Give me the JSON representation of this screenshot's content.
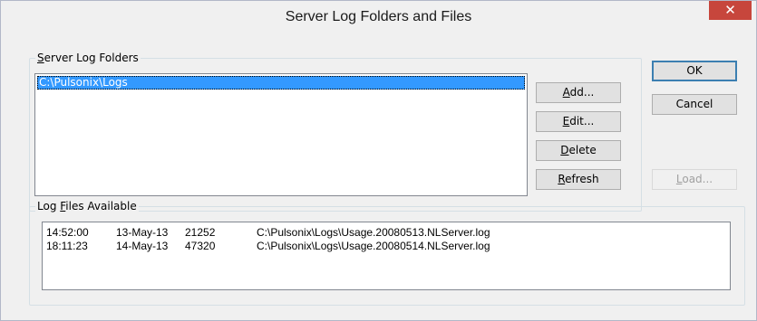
{
  "window": {
    "title": "Server Log Folders and Files",
    "close_glyph": "✕"
  },
  "folders_group": {
    "label_pre": "",
    "label_accel": "S",
    "label_post": "erver Log Folders",
    "items": [
      "C:\\Pulsonix\\Logs"
    ]
  },
  "buttons": {
    "add": {
      "pre": "",
      "accel": "A",
      "post": "dd..."
    },
    "edit": {
      "pre": "",
      "accel": "E",
      "post": "dit..."
    },
    "delete": {
      "pre": "",
      "accel": "D",
      "post": "elete"
    },
    "refresh": {
      "pre": "",
      "accel": "R",
      "post": "efresh"
    },
    "ok": "OK",
    "cancel": "Cancel",
    "load": {
      "pre": "",
      "accel": "L",
      "post": "oad..."
    }
  },
  "files_group": {
    "label_pre": "Log ",
    "label_accel": "F",
    "label_post": "iles Available",
    "rows": [
      {
        "time": "14:52:00",
        "date": "13-May-13",
        "size": "21252",
        "path": "C:\\Pulsonix\\Logs\\Usage.20080513.NLServer.log"
      },
      {
        "time": "18:11:23",
        "date": "14-May-13",
        "size": "47320",
        "path": "C:\\Pulsonix\\Logs\\Usage.20080514.NLServer.log"
      }
    ]
  },
  "colors": {
    "selection": "#3399ff",
    "close_button": "#c7463c",
    "dialog_bg": "#f0f0f0"
  }
}
